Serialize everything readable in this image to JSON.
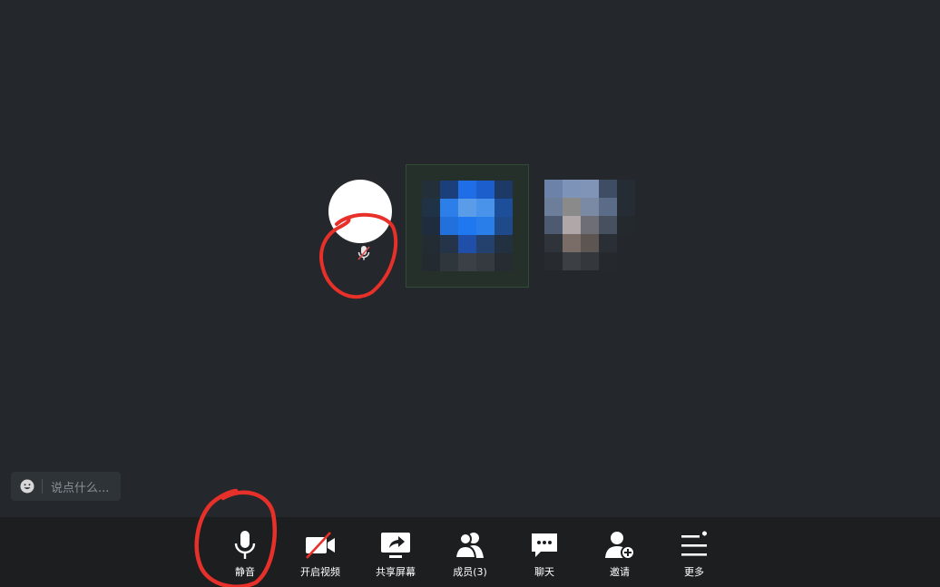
{
  "toolbar": {
    "mute_label": "静音",
    "video_label": "开启视频",
    "share_label": "共享屏幕",
    "members_label": "成员(3)",
    "chat_label": "聊天",
    "invite_label": "邀请",
    "more_label": "更多"
  },
  "chat": {
    "placeholder": "说点什么..."
  },
  "participants": {
    "count": 3
  },
  "colors": {
    "background": "#24282c",
    "toolbar": "#1c1e20",
    "annotation": "#e8302a",
    "active_speaker_border": "#2f4a35"
  },
  "icons": [
    "smile-icon",
    "microphone-icon",
    "video-off-icon",
    "share-screen-icon",
    "members-icon",
    "chat-icon",
    "invite-icon",
    "more-icon"
  ]
}
